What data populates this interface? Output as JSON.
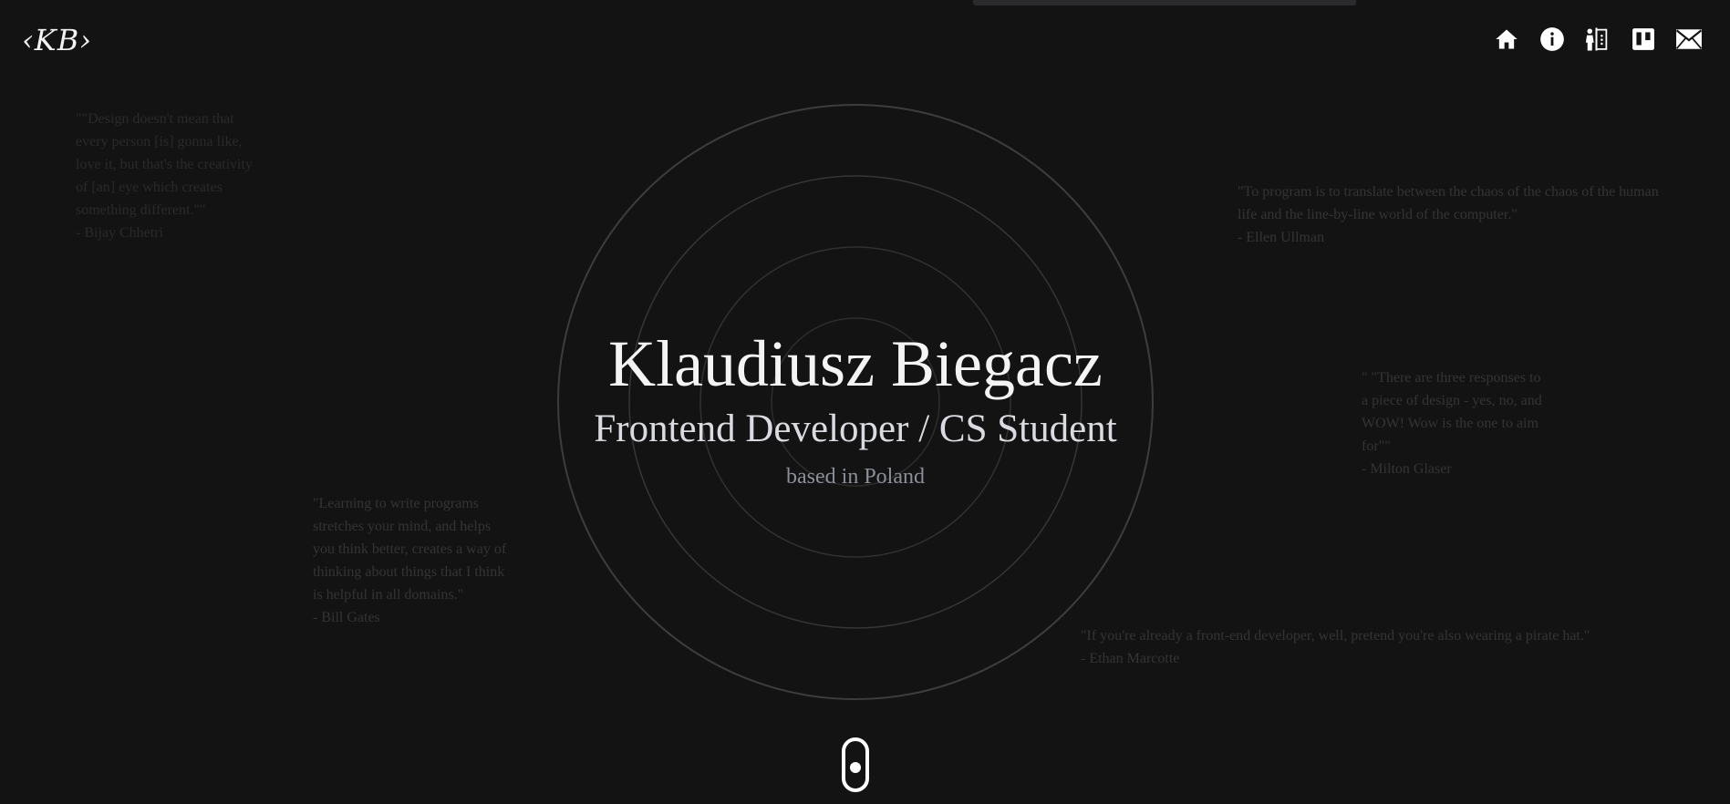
{
  "logo": {
    "text": "‹KB›"
  },
  "nav": {
    "items": [
      {
        "icon": "home-icon",
        "label": "Home"
      },
      {
        "icon": "info-icon",
        "label": "About"
      },
      {
        "icon": "presentation-icon",
        "label": "Skills"
      },
      {
        "icon": "trello-board-icon",
        "label": "Projects"
      },
      {
        "icon": "mail-icon",
        "label": "Contact"
      }
    ]
  },
  "hero": {
    "name": "Klaudiusz Biegacz",
    "role": "Frontend Developer / CS Student",
    "location": "based in Poland"
  },
  "quotes": [
    {
      "text": "\"\"Design doesn't mean that every person [is] gonna like, love it, but that's the creativity of [an] eye which creates something different.\"\"",
      "author": "- Bijay Chhetri"
    },
    {
      "text": "\"To program is to translate between the chaos of the chaos of the human life and the line-by-line world of the computer.\"",
      "author": "- Ellen Ullman"
    },
    {
      "text": "\" \"There are three responses to a piece of design - yes, no, and WOW! Wow is the one to aim for\"\"",
      "author": "- Milton Glaser"
    },
    {
      "text": "\"Learning to write programs stretches your mind, and helps you think better, creates a way of thinking about things that I think is helpful in all domains.\"",
      "author": "- Bill Gates"
    },
    {
      "text": "\"If you're already a front-end developer, well, pretend you're also wearing a pirate hat.\"",
      "author": "- Ethan Marcotte"
    }
  ],
  "colors": {
    "background": "#131313",
    "ring": "#3a3a3a",
    "foreground": "#f4f4f4"
  }
}
